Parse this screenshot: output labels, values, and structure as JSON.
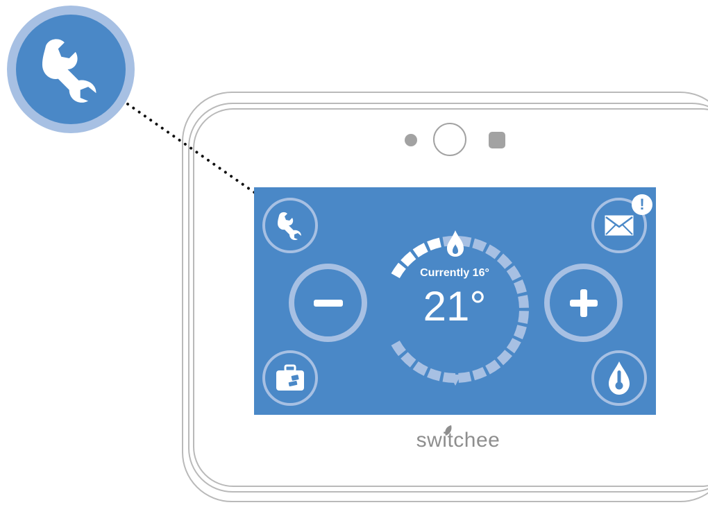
{
  "callout": {
    "icon": "wrench-icon"
  },
  "device": {
    "brand": "switchee",
    "screen": {
      "current_label": "Currently 16°",
      "target_temp": "21°",
      "buttons": {
        "settings": {
          "icon": "wrench-icon"
        },
        "messages": {
          "icon": "envelope-icon",
          "badge": "!"
        },
        "decrease": {
          "icon": "minus-icon"
        },
        "increase": {
          "icon": "plus-icon"
        },
        "holiday": {
          "icon": "suitcase-icon"
        },
        "boost": {
          "icon": "thermometer-drop-icon"
        }
      },
      "dial": {
        "heating_icon": "flame-icon",
        "pointer_icon": "dial-pointer-icon"
      }
    }
  },
  "colors": {
    "screen_blue": "#4a88c7",
    "ring_light_blue": "#a7c0e3",
    "device_grey": "#b9b9b9",
    "brand_grey": "#8e8e8e"
  }
}
